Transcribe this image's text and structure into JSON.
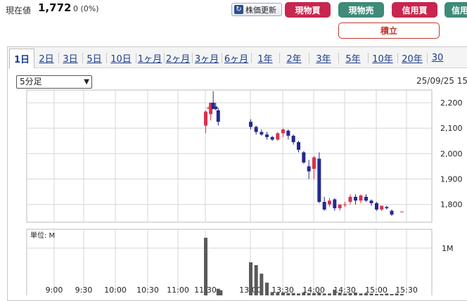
{
  "header": {
    "price_label": "現在値",
    "price_value": "1,772",
    "price_change": "0 (0%)",
    "refresh_label": "株価更新",
    "buttons": [
      {
        "label": "現物買",
        "kind": "buy"
      },
      {
        "label": "現物売",
        "kind": "sell"
      },
      {
        "label": "信用買",
        "kind": "buy"
      },
      {
        "label": "信用",
        "kind": "sell"
      }
    ],
    "tsumitate_label": "積立"
  },
  "tabs": [
    "1日",
    "2日",
    "3日",
    "5日",
    "10日",
    "1ヶ月",
    "2ヶ月",
    "3ヶ月",
    "6ヶ月",
    "1年",
    "2年",
    "3年",
    "5年",
    "10年",
    "20年",
    "30"
  ],
  "active_tab": "1日",
  "interval_select": {
    "value": "5分足"
  },
  "timestamp": "25/09/25 15",
  "colors": {
    "up": "#d8334a",
    "down": "#232a8f",
    "volume": "#5a5a5a",
    "buy": "#c8264f",
    "sell": "#3f8a78"
  },
  "chart_data": [
    {
      "type": "candlestick",
      "x_axis_labels": [
        "9:00",
        "9:30",
        "10:00",
        "10:30",
        "11:00",
        "11:30",
        "13:00",
        "13:30",
        "14:00",
        "14:30",
        "15:00",
        "15:30"
      ],
      "y_ticks": [
        "2,200",
        "2,100",
        "2,000",
        "1,900",
        "1,800"
      ],
      "ylim": [
        1730,
        2250
      ],
      "candles": [
        {
          "t": "11:30",
          "o": 2110,
          "h": 2170,
          "l": 2080,
          "c": 2165
        },
        {
          "t": "11:35",
          "o": 2180,
          "h": 2185,
          "l": 2175,
          "c": 2180
        },
        {
          "t": "11:40",
          "o": 2155,
          "h": 2200,
          "l": 2130,
          "c": 2200
        },
        {
          "t": "11:45",
          "o": 2200,
          "h": 2245,
          "l": 2175,
          "c": 2175
        },
        {
          "t": "11:50",
          "o": 2185,
          "h": 2200,
          "l": 2170,
          "c": 2175
        },
        {
          "t": "11:55",
          "o": 2170,
          "h": 2180,
          "l": 2110,
          "c": 2125
        },
        {
          "t": "13:00",
          "o": 2125,
          "h": 2135,
          "l": 2095,
          "c": 2105
        },
        {
          "t": "13:05",
          "o": 2105,
          "h": 2110,
          "l": 2075,
          "c": 2085
        },
        {
          "t": "13:10",
          "o": 2085,
          "h": 2095,
          "l": 2070,
          "c": 2075
        },
        {
          "t": "13:15",
          "o": 2075,
          "h": 2085,
          "l": 2055,
          "c": 2065
        },
        {
          "t": "13:20",
          "o": 2065,
          "h": 2070,
          "l": 2050,
          "c": 2055
        },
        {
          "t": "13:25",
          "o": 2055,
          "h": 2085,
          "l": 2050,
          "c": 2080
        },
        {
          "t": "13:30",
          "o": 2080,
          "h": 2100,
          "l": 2065,
          "c": 2095
        },
        {
          "t": "13:35",
          "o": 2090,
          "h": 2095,
          "l": 2055,
          "c": 2070
        },
        {
          "t": "13:40",
          "o": 2070,
          "h": 2075,
          "l": 2035,
          "c": 2045
        },
        {
          "t": "13:45",
          "o": 2045,
          "h": 2050,
          "l": 2005,
          "c": 2015
        },
        {
          "t": "13:50",
          "o": 2005,
          "h": 2010,
          "l": 1960,
          "c": 1965
        },
        {
          "t": "13:55",
          "o": 1950,
          "h": 1975,
          "l": 1900,
          "c": 1930
        },
        {
          "t": "14:00",
          "o": 1940,
          "h": 1990,
          "l": 1900,
          "c": 1985
        },
        {
          "t": "14:05",
          "o": 1980,
          "h": 2005,
          "l": 1805,
          "c": 1810
        },
        {
          "t": "14:10",
          "o": 1810,
          "h": 1830,
          "l": 1775,
          "c": 1780
        },
        {
          "t": "14:15",
          "o": 1800,
          "h": 1825,
          "l": 1790,
          "c": 1815
        },
        {
          "t": "14:20",
          "o": 1820,
          "h": 1825,
          "l": 1775,
          "c": 1785
        },
        {
          "t": "14:25",
          "o": 1785,
          "h": 1800,
          "l": 1775,
          "c": 1800
        },
        {
          "t": "14:30",
          "o": 1800,
          "h": 1810,
          "l": 1790,
          "c": 1800
        },
        {
          "t": "14:35",
          "o": 1810,
          "h": 1840,
          "l": 1800,
          "c": 1830
        },
        {
          "t": "14:40",
          "o": 1830,
          "h": 1840,
          "l": 1800,
          "c": 1815
        },
        {
          "t": "14:45",
          "o": 1815,
          "h": 1840,
          "l": 1805,
          "c": 1835
        },
        {
          "t": "14:50",
          "o": 1830,
          "h": 1840,
          "l": 1810,
          "c": 1815
        },
        {
          "t": "14:55",
          "o": 1815,
          "h": 1820,
          "l": 1795,
          "c": 1805
        },
        {
          "t": "15:00",
          "o": 1805,
          "h": 1810,
          "l": 1775,
          "c": 1780
        },
        {
          "t": "15:05",
          "o": 1780,
          "h": 1795,
          "l": 1775,
          "c": 1795
        },
        {
          "t": "15:10",
          "o": 1790,
          "h": 1795,
          "l": 1780,
          "c": 1785
        },
        {
          "t": "15:15",
          "o": 1775,
          "h": 1780,
          "l": 1755,
          "c": 1760
        },
        {
          "t": "15:25",
          "o": 1772,
          "h": 1772,
          "l": 1772,
          "c": 1772
        }
      ]
    },
    {
      "type": "bar",
      "title": "単位: M",
      "y_ticks": [
        "1M"
      ],
      "ylim": [
        0,
        1.4
      ],
      "volumes": [
        {
          "t": "11:30",
          "v": 1.22
        },
        {
          "t": "11:55",
          "v": 0.14
        },
        {
          "t": "12:00",
          "v": 0.11
        },
        {
          "t": "13:00",
          "v": 0.7
        },
        {
          "t": "13:05",
          "v": 0.64
        },
        {
          "t": "13:10",
          "v": 0.46
        },
        {
          "t": "13:15",
          "v": 0.27
        },
        {
          "t": "13:20",
          "v": 0.07
        },
        {
          "t": "13:25",
          "v": 0.06
        },
        {
          "t": "13:30",
          "v": 0.06
        },
        {
          "t": "13:35",
          "v": 0.05
        },
        {
          "t": "13:40",
          "v": 0.05
        },
        {
          "t": "13:45",
          "v": 0.04
        },
        {
          "t": "13:50",
          "v": 0.06
        },
        {
          "t": "13:55",
          "v": 0.05
        },
        {
          "t": "14:00",
          "v": 0.05
        },
        {
          "t": "14:05",
          "v": 0.06
        },
        {
          "t": "14:10",
          "v": 0.04
        },
        {
          "t": "14:15",
          "v": 0.04
        },
        {
          "t": "14:20",
          "v": 0.12
        },
        {
          "t": "14:25",
          "v": 0.06
        },
        {
          "t": "14:30",
          "v": 0.04
        },
        {
          "t": "14:35",
          "v": 0.05
        },
        {
          "t": "14:40",
          "v": 0.06
        },
        {
          "t": "14:45",
          "v": 0.04
        },
        {
          "t": "14:50",
          "v": 0.05
        },
        {
          "t": "14:55",
          "v": 0.04
        },
        {
          "t": "15:00",
          "v": 0.03
        },
        {
          "t": "15:05",
          "v": 0.03
        },
        {
          "t": "15:10",
          "v": 0.04
        },
        {
          "t": "15:15",
          "v": 0.03
        },
        {
          "t": "15:20",
          "v": 0.04
        },
        {
          "t": "15:25",
          "v": 0.03
        }
      ]
    }
  ]
}
